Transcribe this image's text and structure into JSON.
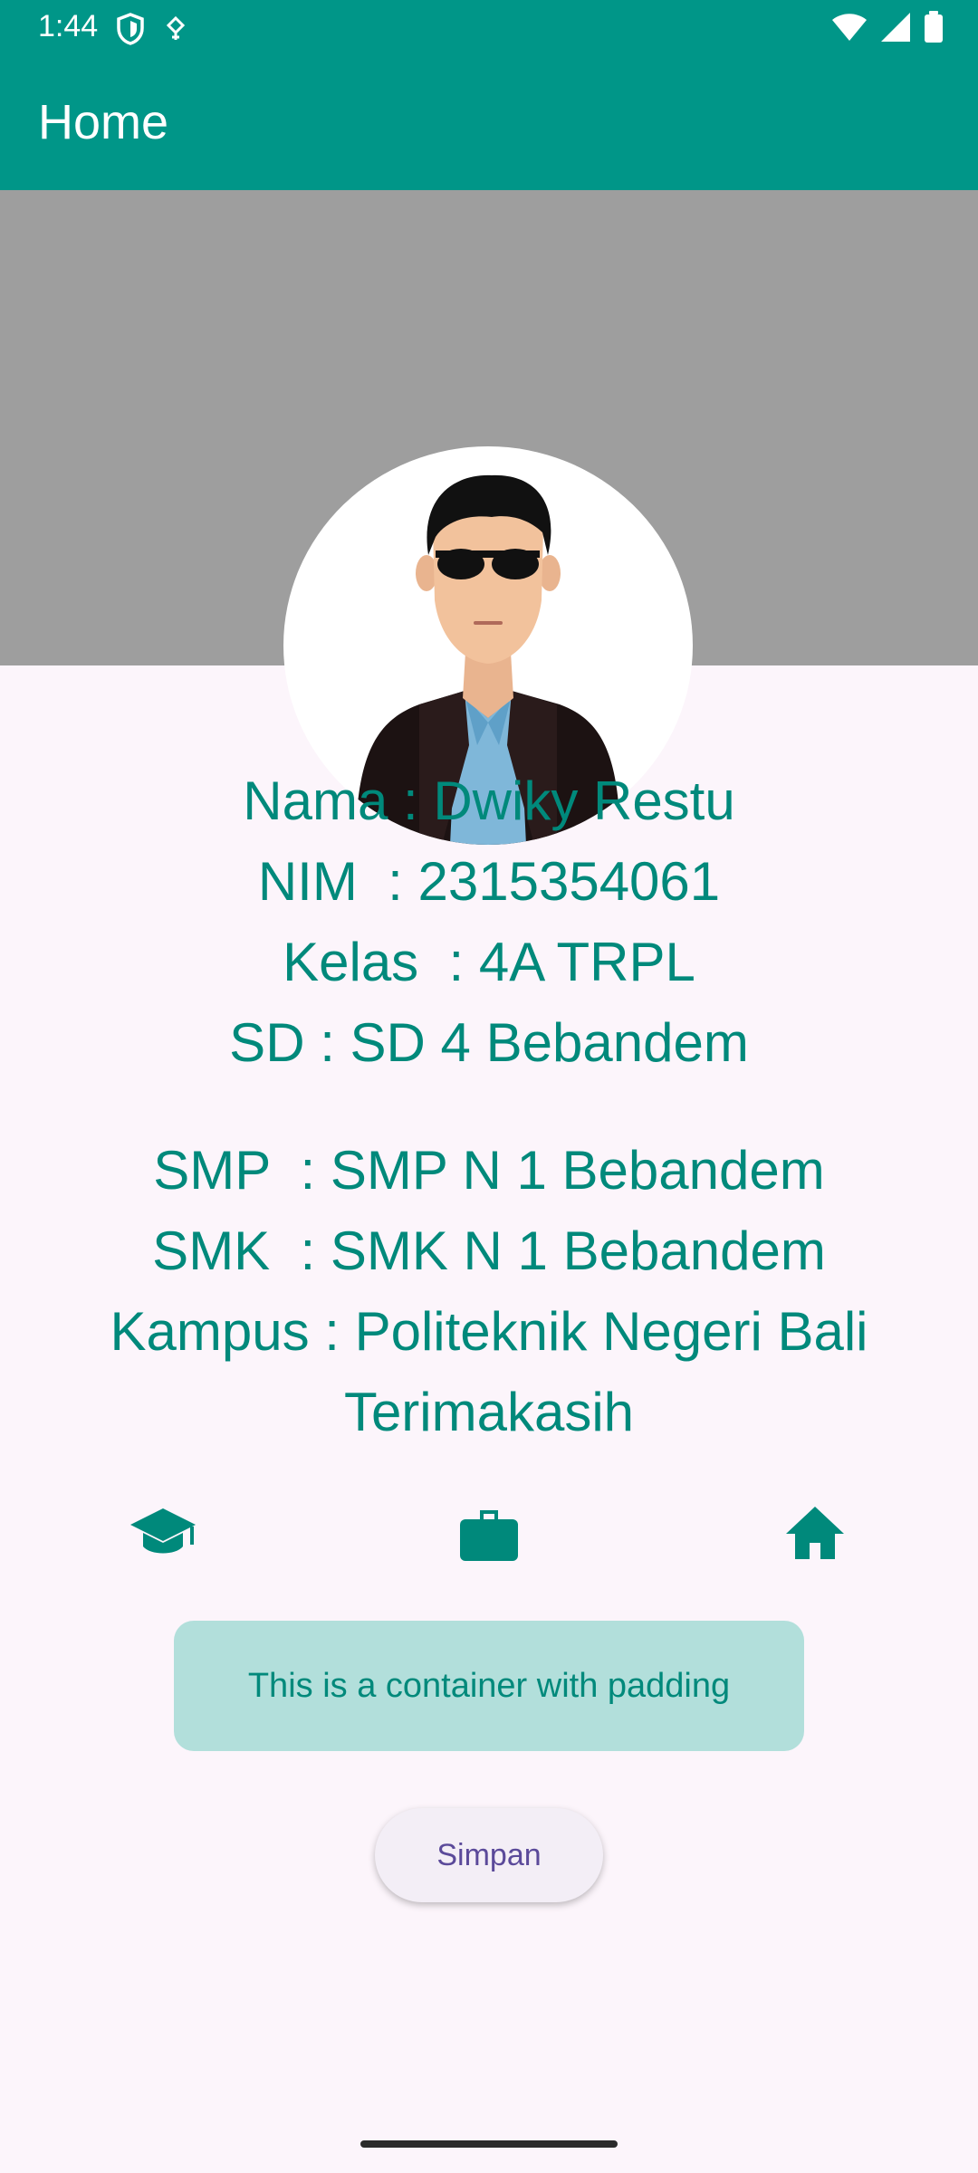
{
  "status_bar": {
    "time": "1:44",
    "icons": [
      "shield-icon",
      "data-saver-icon",
      "wifi-icon",
      "signal-icon",
      "battery-icon"
    ]
  },
  "app_bar": {
    "title": "Home"
  },
  "profile": {
    "avatar": "profile-avatar-illustration",
    "lines": [
      "Nama : Dwiky Restu",
      "NIM  : 2315354061",
      "Kelas  : 4A TRPL",
      "SD : SD 4 Bebandem",
      "SMP  : SMP N 1 Bebandem",
      "SMK  : SMK N 1 Bebandem",
      "Kampus : Politeknik Negeri Bali",
      "Terimakasih"
    ]
  },
  "icon_row": [
    "graduation-cap-icon",
    "briefcase-icon",
    "home-icon"
  ],
  "container": {
    "text": "This is a container with padding"
  },
  "save_button": {
    "label": "Simpan"
  },
  "colors": {
    "primary": "#009688",
    "text_teal": "#00897b",
    "container_bg": "#b2dfdb",
    "cover_gray": "#9e9e9e",
    "page_bg": "#fcf5fb",
    "button_text": "#5b4a9a"
  }
}
